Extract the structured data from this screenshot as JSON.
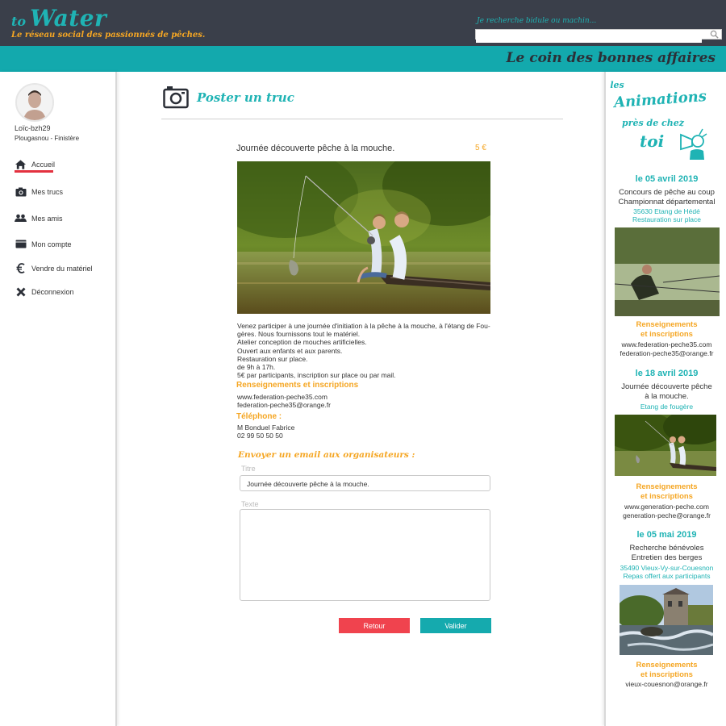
{
  "header": {
    "logo_to": "to",
    "logo_water": "Water",
    "tagline": "Le réseau social des passionnés de pêches.",
    "search_hint": "Je recherche bidule ou machin...",
    "search_value": ""
  },
  "banner": {
    "title": "Le coin des bonnes affaires"
  },
  "profile": {
    "name": "Loïc-bzh29",
    "location": "Plougasnou - Finistère"
  },
  "nav": {
    "home": "Accueil",
    "my_stuff": "Mes trucs",
    "friends": "Mes amis",
    "account": "Mon compte",
    "sell": "Vendre du matériel",
    "logout": "Déconnexion"
  },
  "post": {
    "heading": "Poster un truc",
    "item_title": "Journée découverte pêche à la mouche.",
    "price": "5 €",
    "description": [
      "Venez participer à une journée d'initiation à la pêche à la mouche, à l'étang de Fou-",
      "gères. Nous fournissons tout le matériel.",
      "Atelier conception de mouches artificielles.",
      "Ouvert aux enfants et aux parents.",
      "Restauration sur place.",
      "de 9h à 17h.",
      "5€ par participants, inscription sur place ou par mail."
    ],
    "info_heading": "Renseignements et inscriptions",
    "website": "www.federation-peche35.com",
    "email": "federation-peche35@orange.fr",
    "phone_heading": "Téléphone :",
    "contact_name": "M Bonduel Fabrice",
    "phone": "02 99 50 50 50"
  },
  "email_form": {
    "heading": "Envoyer un email aux organisateurs :",
    "title_label": "Titre",
    "title_value": "Journée découverte pêche à la mouche.",
    "text_label": "Texte",
    "text_value": "",
    "back_button": "Retour",
    "submit_button": "Valider"
  },
  "sidebar": {
    "title_les": "les",
    "title_animations": "Animations",
    "title_pres": "près de chez",
    "title_toi": "toi",
    "events": [
      {
        "date": "le 05 avril 2019",
        "line1": "Concours de pêche au coup",
        "line2": "Championnat départemental",
        "small1": "35630 Etang de Hédé",
        "small2": "Restauration sur place",
        "info1": "Renseignements",
        "info2": "et inscriptions",
        "contact1": "www.federation-peche35.com",
        "contact2": "federation-peche35@orange.fr"
      },
      {
        "date": "le 18 avril 2019",
        "line1": "Journée découverte pêche",
        "line2": "à la mouche.",
        "small1": "Etang de fougère",
        "small2": "",
        "info1": "Renseignements",
        "info2": "et inscriptions",
        "contact1": "www.generation-peche.com",
        "contact2": "generation-peche@orange.fr"
      },
      {
        "date": "le 05 mai 2019",
        "line1": "Recherche bénévoles",
        "line2": "Entretien des berges",
        "small1": "35490 Vieux-Vy-sur-Couesnon",
        "small2": "Repas offert aux participants",
        "info1": "Renseignements",
        "info2": "et inscriptions",
        "contact1": "vieux-couesnon@orange.fr",
        "contact2": ""
      }
    ]
  },
  "colors": {
    "teal": "#13a9ad",
    "dark": "#3a3f4a",
    "orange": "#f5a623",
    "red": "#f0434e"
  }
}
